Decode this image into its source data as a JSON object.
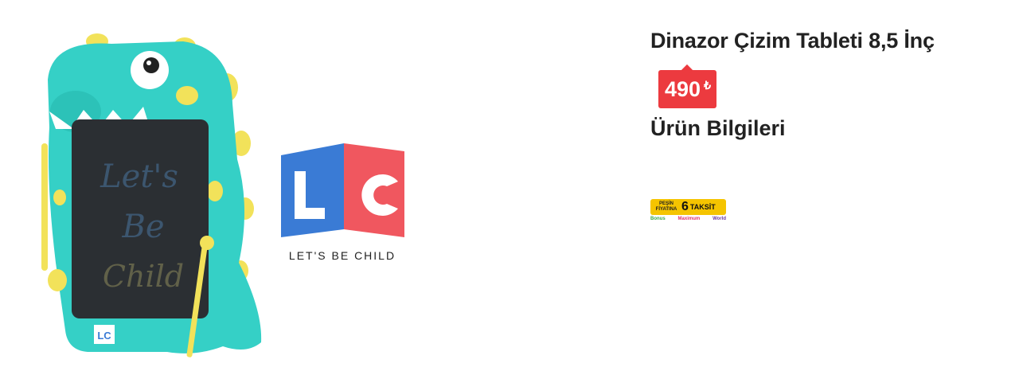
{
  "product": {
    "title": "Dinazor Çizim Tableti 8,5 İnç",
    "price": "490",
    "currency_symbol": "₺",
    "section_title": "Ürün Bilgileri"
  },
  "image": {
    "screen_text_line1": "Let's",
    "screen_text_line2": "Be",
    "screen_text_line3": "Child",
    "logo_letters": "LC",
    "brand_tagline": "LET'S BE CHILD"
  },
  "installment": {
    "pesin_label": "PEŞİN FİYATINA",
    "count": "6",
    "taksit_label": "TAKSİT",
    "card1": "Bonus",
    "card2": "Maximum",
    "card3": "World"
  },
  "colors": {
    "price_red": "#ec3a3f",
    "dino_teal": "#35d0c6",
    "spot_yellow": "#f2e25a",
    "logo_blue": "#3a7bd5",
    "logo_red": "#f0575f",
    "taksit_yellow": "#f5c400"
  }
}
